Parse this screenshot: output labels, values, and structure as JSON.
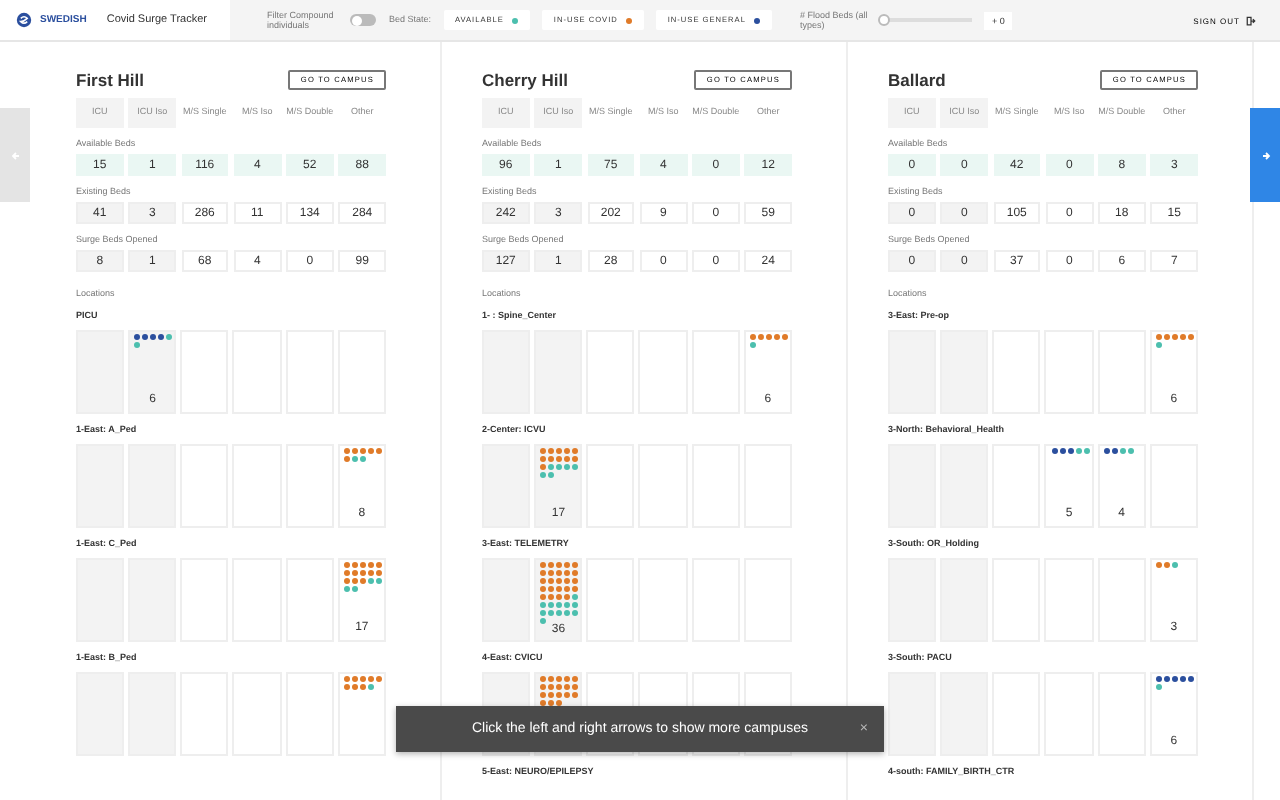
{
  "header": {
    "logo": "SWEDISH",
    "title": "Covid Surge Tracker",
    "filter": {
      "label": "Filter Compound individuals",
      "on": false
    },
    "bed_state_label": "Bed State:",
    "legend": [
      {
        "label": "AVAILABLE",
        "color": "#4cbfae"
      },
      {
        "label": "IN-USE COVID",
        "color": "#e07b29"
      },
      {
        "label": "IN-USE GENERAL",
        "color": "#2b4f9e"
      }
    ],
    "flood": {
      "label": "# Flood Beds (all types)",
      "level": 0,
      "value": "+ 0"
    },
    "sign_out": "SIGN OUT"
  },
  "campuses": [
    {
      "name": "First Hill",
      "button": "GO TO CAMPUS",
      "columns": [
        "ICU",
        "ICU Iso",
        "M/S Single",
        "M/S Iso",
        "M/S Double",
        "Other"
      ],
      "stats": [
        {
          "kind": "available",
          "label": "Available Beds",
          "values": [
            "15",
            "1",
            "116",
            "4",
            "52",
            "88"
          ]
        },
        {
          "kind": "existing",
          "label": "Existing Beds",
          "values": [
            "41",
            "3",
            "286",
            "11",
            "134",
            "284"
          ]
        },
        {
          "kind": "surge",
          "label": "Surge Beds Opened",
          "values": [
            "8",
            "1",
            "68",
            "4",
            "0",
            "99"
          ]
        }
      ],
      "locations_label": "Locations",
      "locations": [
        {
          "name": "PICU",
          "cells": [
            {},
            {
              "count": "6",
              "dots": [
                {
                  "color": "#2b4f9e"
                },
                {
                  "color": "#2b4f9e"
                },
                {
                  "color": "#2b4f9e"
                },
                {
                  "color": "#2b4f9e"
                },
                {
                  "color": "#4cbfae"
                },
                {
                  "color": "#4cbfae"
                }
              ]
            },
            {},
            {},
            {},
            {}
          ]
        },
        {
          "name": "1-East: A_Ped",
          "cells": [
            {},
            {},
            {},
            {},
            {},
            {
              "count": "8",
              "dots": [
                {
                  "color": "#e07b29"
                },
                {
                  "color": "#e07b29"
                },
                {
                  "color": "#e07b29"
                },
                {
                  "color": "#e07b29"
                },
                {
                  "color": "#e07b29"
                },
                {
                  "color": "#e07b29"
                },
                {
                  "color": "#4cbfae"
                },
                {
                  "color": "#4cbfae"
                }
              ]
            }
          ]
        },
        {
          "name": "1-East: C_Ped",
          "cells": [
            {},
            {},
            {},
            {},
            {},
            {
              "count": "17",
              "dots": [
                {
                  "color": "#e07b29"
                },
                {
                  "color": "#e07b29"
                },
                {
                  "color": "#e07b29"
                },
                {
                  "color": "#e07b29"
                },
                {
                  "color": "#e07b29"
                },
                {
                  "color": "#e07b29"
                },
                {
                  "color": "#e07b29"
                },
                {
                  "color": "#e07b29"
                },
                {
                  "color": "#e07b29"
                },
                {
                  "color": "#e07b29"
                },
                {
                  "color": "#e07b29"
                },
                {
                  "color": "#e07b29"
                },
                {
                  "color": "#e07b29"
                },
                {
                  "color": "#4cbfae"
                },
                {
                  "color": "#4cbfae"
                },
                {
                  "color": "#4cbfae"
                },
                {
                  "color": "#4cbfae"
                }
              ]
            }
          ]
        },
        {
          "name": "1-East: B_Ped",
          "cells": [
            {},
            {},
            {},
            {},
            {},
            {
              "dots": [
                {
                  "color": "#e07b29"
                },
                {
                  "color": "#e07b29"
                },
                {
                  "color": "#e07b29"
                },
                {
                  "color": "#e07b29"
                },
                {
                  "color": "#e07b29"
                },
                {
                  "color": "#e07b29"
                },
                {
                  "color": "#e07b29"
                },
                {
                  "color": "#e07b29"
                },
                {
                  "color": "#4cbfae"
                }
              ]
            }
          ]
        }
      ]
    },
    {
      "name": "Cherry Hill",
      "button": "GO TO CAMPUS",
      "columns": [
        "ICU",
        "ICU Iso",
        "M/S Single",
        "M/S Iso",
        "M/S Double",
        "Other"
      ],
      "stats": [
        {
          "kind": "available",
          "label": "Available Beds",
          "values": [
            "96",
            "1",
            "75",
            "4",
            "0",
            "12"
          ]
        },
        {
          "kind": "existing",
          "label": "Existing Beds",
          "values": [
            "242",
            "3",
            "202",
            "9",
            "0",
            "59"
          ]
        },
        {
          "kind": "surge",
          "label": "Surge Beds Opened",
          "values": [
            "127",
            "1",
            "28",
            "0",
            "0",
            "24"
          ]
        }
      ],
      "locations_label": "Locations",
      "locations": [
        {
          "name": "1- : Spine_Center",
          "cells": [
            {},
            {},
            {},
            {},
            {},
            {
              "count": "6",
              "dots": [
                {
                  "color": "#e07b29"
                },
                {
                  "color": "#e07b29"
                },
                {
                  "color": "#e07b29"
                },
                {
                  "color": "#e07b29"
                },
                {
                  "color": "#e07b29"
                },
                {
                  "color": "#4cbfae"
                }
              ]
            }
          ]
        },
        {
          "name": "2-Center: ICVU",
          "cells": [
            {},
            {
              "count": "17",
              "dots": [
                {
                  "color": "#e07b29"
                },
                {
                  "color": "#e07b29"
                },
                {
                  "color": "#e07b29"
                },
                {
                  "color": "#e07b29"
                },
                {
                  "color": "#e07b29"
                },
                {
                  "color": "#e07b29"
                },
                {
                  "color": "#e07b29"
                },
                {
                  "color": "#e07b29"
                },
                {
                  "color": "#e07b29"
                },
                {
                  "color": "#e07b29"
                },
                {
                  "color": "#e07b29"
                },
                {
                  "color": "#4cbfae"
                },
                {
                  "color": "#4cbfae"
                },
                {
                  "color": "#4cbfae"
                },
                {
                  "color": "#4cbfae"
                },
                {
                  "color": "#4cbfae"
                },
                {
                  "color": "#4cbfae"
                }
              ]
            },
            {},
            {},
            {},
            {}
          ]
        },
        {
          "name": "3-East: TELEMETRY",
          "cells": [
            {},
            {
              "count": "36",
              "dots": [
                {
                  "color": "#e07b29"
                },
                {
                  "color": "#e07b29"
                },
                {
                  "color": "#e07b29"
                },
                {
                  "color": "#e07b29"
                },
                {
                  "color": "#e07b29"
                },
                {
                  "color": "#e07b29"
                },
                {
                  "color": "#e07b29"
                },
                {
                  "color": "#e07b29"
                },
                {
                  "color": "#e07b29"
                },
                {
                  "color": "#e07b29"
                },
                {
                  "color": "#e07b29"
                },
                {
                  "color": "#e07b29"
                },
                {
                  "color": "#e07b29"
                },
                {
                  "color": "#e07b29"
                },
                {
                  "color": "#e07b29"
                },
                {
                  "color": "#e07b29"
                },
                {
                  "color": "#e07b29"
                },
                {
                  "color": "#e07b29"
                },
                {
                  "color": "#e07b29"
                },
                {
                  "color": "#e07b29"
                },
                {
                  "color": "#e07b29"
                },
                {
                  "color": "#e07b29"
                },
                {
                  "color": "#e07b29"
                },
                {
                  "color": "#e07b29"
                },
                {
                  "color": "#4cbfae"
                },
                {
                  "color": "#4cbfae"
                },
                {
                  "color": "#4cbfae"
                },
                {
                  "color": "#4cbfae"
                },
                {
                  "color": "#4cbfae"
                },
                {
                  "color": "#4cbfae"
                },
                {
                  "color": "#4cbfae"
                },
                {
                  "color": "#4cbfae"
                },
                {
                  "color": "#4cbfae"
                },
                {
                  "color": "#4cbfae"
                },
                {
                  "color": "#4cbfae"
                },
                {
                  "color": "#4cbfae"
                }
              ]
            },
            {},
            {},
            {},
            {}
          ]
        },
        {
          "name": "4-East: CVICU",
          "cells": [
            {},
            {
              "dots": [
                {
                  "color": "#e07b29"
                },
                {
                  "color": "#e07b29"
                },
                {
                  "color": "#e07b29"
                },
                {
                  "color": "#e07b29"
                },
                {
                  "color": "#e07b29"
                },
                {
                  "color": "#e07b29"
                },
                {
                  "color": "#e07b29"
                },
                {
                  "color": "#e07b29"
                },
                {
                  "color": "#e07b29"
                },
                {
                  "color": "#e07b29"
                },
                {
                  "color": "#e07b29"
                },
                {
                  "color": "#e07b29"
                },
                {
                  "color": "#e07b29"
                },
                {
                  "color": "#e07b29"
                },
                {
                  "color": "#e07b29"
                },
                {
                  "color": "#e07b29"
                },
                {
                  "color": "#e07b29"
                },
                {
                  "color": "#e07b29"
                }
              ]
            },
            {},
            {},
            {},
            {}
          ]
        },
        {
          "name": "5-East: NEURO/EPILEPSY"
        }
      ]
    },
    {
      "name": "Ballard",
      "button": "GO TO CAMPUS",
      "columns": [
        "ICU",
        "ICU Iso",
        "M/S Single",
        "M/S Iso",
        "M/S Double",
        "Other"
      ],
      "stats": [
        {
          "kind": "available",
          "label": "Available Beds",
          "values": [
            "0",
            "0",
            "42",
            "0",
            "8",
            "3"
          ]
        },
        {
          "kind": "existing",
          "label": "Existing Beds",
          "values": [
            "0",
            "0",
            "105",
            "0",
            "18",
            "15"
          ]
        },
        {
          "kind": "surge",
          "label": "Surge Beds Opened",
          "values": [
            "0",
            "0",
            "37",
            "0",
            "6",
            "7"
          ]
        }
      ],
      "locations_label": "Locations",
      "locations": [
        {
          "name": "3-East: Pre-op",
          "cells": [
            {},
            {},
            {},
            {},
            {},
            {
              "count": "6",
              "dots": [
                {
                  "color": "#e07b29"
                },
                {
                  "color": "#e07b29"
                },
                {
                  "color": "#e07b29"
                },
                {
                  "color": "#e07b29"
                },
                {
                  "color": "#e07b29"
                },
                {
                  "color": "#4cbfae"
                }
              ]
            }
          ]
        },
        {
          "name": "3-North: Behavioral_Health",
          "cells": [
            {},
            {},
            {},
            {
              "count": "5",
              "dots": [
                {
                  "color": "#2b4f9e"
                },
                {
                  "color": "#2b4f9e"
                },
                {
                  "color": "#2b4f9e"
                },
                {
                  "color": "#4cbfae"
                },
                {
                  "color": "#4cbfae"
                }
              ]
            },
            {
              "count": "4",
              "dots": [
                {
                  "color": "#2b4f9e"
                },
                {
                  "color": "#2b4f9e"
                },
                {
                  "color": "#4cbfae"
                },
                {
                  "color": "#4cbfae"
                }
              ]
            },
            {}
          ]
        },
        {
          "name": "3-South: OR_Holding",
          "cells": [
            {},
            {},
            {},
            {},
            {},
            {
              "count": "3",
              "dots": [
                {
                  "color": "#e07b29"
                },
                {
                  "color": "#e07b29"
                },
                {
                  "color": "#4cbfae"
                }
              ]
            }
          ]
        },
        {
          "name": "3-South: PACU",
          "cells": [
            {},
            {},
            {},
            {},
            {},
            {
              "count": "6",
              "dots": [
                {
                  "color": "#2b4f9e"
                },
                {
                  "color": "#2b4f9e"
                },
                {
                  "color": "#2b4f9e"
                },
                {
                  "color": "#2b4f9e"
                },
                {
                  "color": "#2b4f9e"
                },
                {
                  "color": "#4cbfae"
                }
              ]
            }
          ]
        },
        {
          "name": "4-south: FAMILY_BIRTH_CTR"
        }
      ]
    }
  ],
  "toast": {
    "message": "Click the left and right arrows to show more campuses",
    "close": "×"
  }
}
